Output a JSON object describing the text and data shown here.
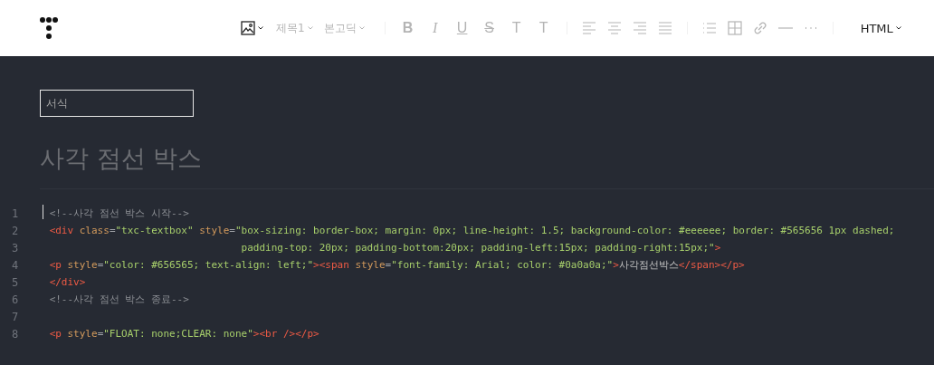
{
  "toolbar": {
    "items": [
      {
        "kind": "image-menu",
        "disabled": false
      },
      {
        "kind": "text-menu",
        "label": "제목1",
        "disabled": true
      },
      {
        "kind": "text-menu",
        "label": "본고딕",
        "disabled": true
      },
      {
        "kind": "bold",
        "label": "B",
        "disabled": true
      },
      {
        "kind": "italic",
        "label": "I",
        "disabled": true
      },
      {
        "kind": "underline",
        "label": "U",
        "disabled": true
      },
      {
        "kind": "strike",
        "label": "S",
        "disabled": true
      },
      {
        "kind": "plain",
        "label": "T",
        "disabled": true
      },
      {
        "kind": "plain",
        "label": "T",
        "disabled": true
      },
      {
        "kind": "align-left",
        "disabled": true
      },
      {
        "kind": "align-center",
        "disabled": true
      },
      {
        "kind": "align-right",
        "disabled": true
      },
      {
        "kind": "justify",
        "disabled": true
      },
      {
        "kind": "list",
        "disabled": true
      },
      {
        "kind": "table",
        "disabled": true
      },
      {
        "kind": "link",
        "disabled": true
      },
      {
        "kind": "rule",
        "disabled": true
      },
      {
        "kind": "more",
        "disabled": true
      }
    ],
    "mode": {
      "label": "HTML"
    }
  },
  "category_field": {
    "placeholder": "서식"
  },
  "title": "사각 점선 박스",
  "code": {
    "lines": [
      {
        "number": "1",
        "continued": false,
        "tokens": [
          {
            "kind": "comment",
            "text": "<!--사각 점선 박스 시작-->"
          }
        ]
      },
      {
        "number": "2",
        "continued": false,
        "tokens": [
          {
            "kind": "tag",
            "text": "<div"
          },
          {
            "kind": "attr",
            "text": " class"
          },
          {
            "kind": "punct",
            "text": "="
          },
          {
            "kind": "value",
            "text": "\"txc-textbox\""
          },
          {
            "kind": "attr",
            "text": " style"
          },
          {
            "kind": "punct",
            "text": "="
          },
          {
            "kind": "value",
            "text": "\"box-sizing: border-box; margin: 0px; line-height: 1.5; background-color: #eeeeee; border: #565656 1px dashed;"
          }
        ]
      },
      {
        "number": "3",
        "continued": true,
        "tokens": [
          {
            "kind": "value",
            "text": "padding-top: 20px; padding-bottom:20px; padding-left:15px; padding-right:15px;\""
          },
          {
            "kind": "tag",
            "text": ">"
          }
        ]
      },
      {
        "number": "4",
        "continued": false,
        "tokens": [
          {
            "kind": "tag",
            "text": "<p"
          },
          {
            "kind": "attr",
            "text": " style"
          },
          {
            "kind": "punct",
            "text": "="
          },
          {
            "kind": "value",
            "text": "\"color: #656565; text-align: left;\""
          },
          {
            "kind": "tag",
            "text": "><span"
          },
          {
            "kind": "attr",
            "text": " style"
          },
          {
            "kind": "punct",
            "text": "="
          },
          {
            "kind": "value",
            "text": "\"font-family: Arial; color: #0a0a0a;\""
          },
          {
            "kind": "tag",
            "text": ">"
          },
          {
            "kind": "text",
            "text": "사각점선박스"
          },
          {
            "kind": "tag",
            "text": "</span></p>"
          }
        ]
      },
      {
        "number": "5",
        "continued": false,
        "tokens": [
          {
            "kind": "tag",
            "text": "</div>"
          }
        ]
      },
      {
        "number": "6",
        "continued": false,
        "tokens": [
          {
            "kind": "comment",
            "text": "<!--사각 점선 박스 종료-->"
          }
        ]
      },
      {
        "number": "7",
        "continued": false
      },
      {
        "number": "8",
        "continued": false,
        "tokens": [
          {
            "kind": "tag",
            "text": "<p"
          },
          {
            "kind": "attr",
            "text": " style"
          },
          {
            "kind": "punct",
            "text": "="
          },
          {
            "kind": "value",
            "text": "\"FLOAT: none;CLEAR: none\""
          },
          {
            "kind": "tag",
            "text": "><br /></p>"
          }
        ]
      }
    ]
  }
}
